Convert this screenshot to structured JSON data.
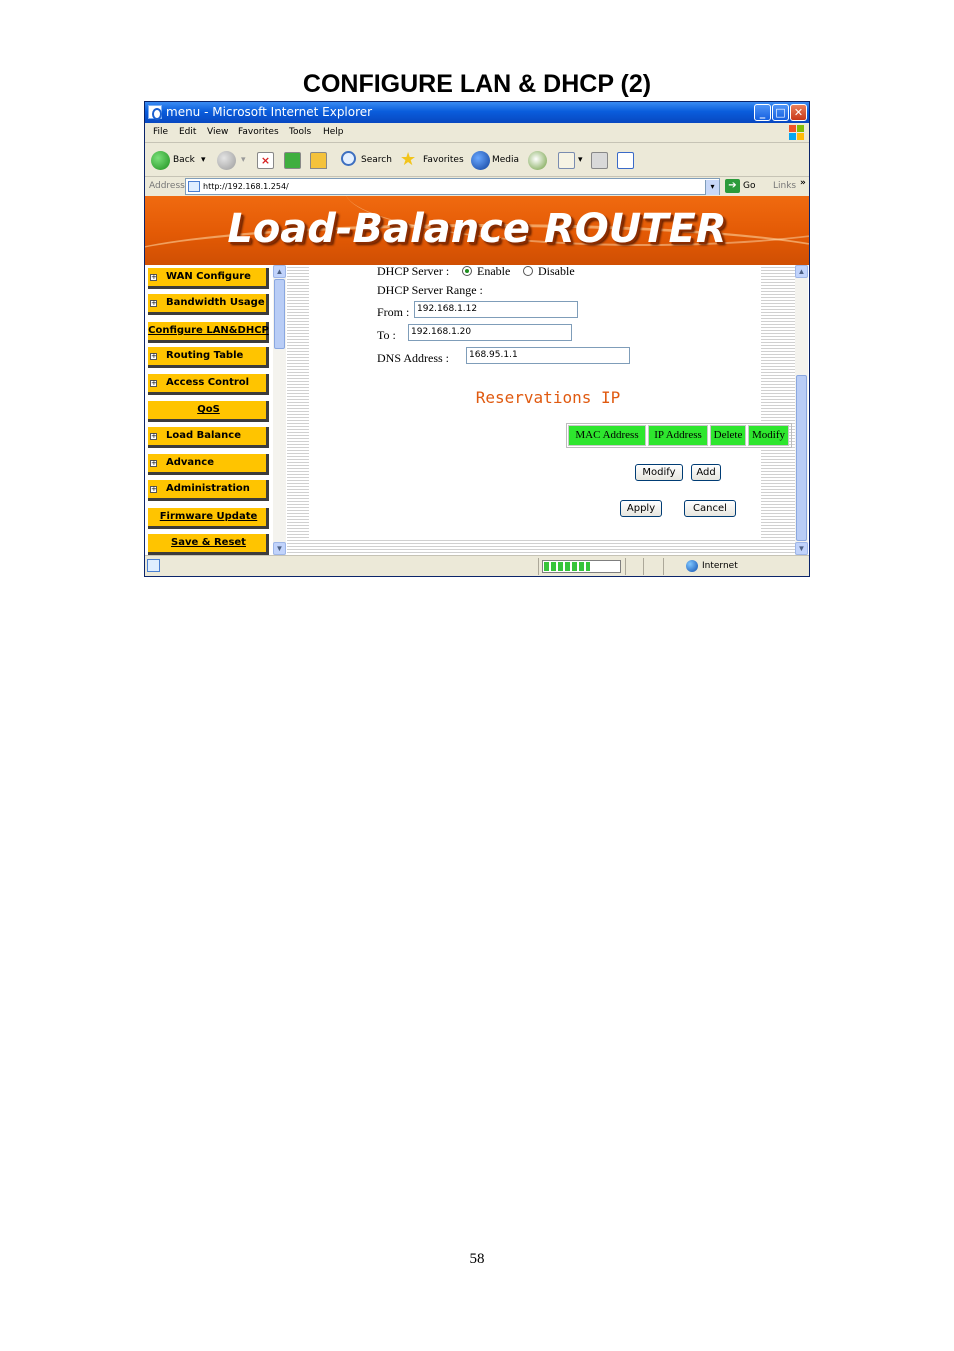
{
  "document": {
    "title": "CONFIGURE LAN & DHCP (2)",
    "page_number": "58"
  },
  "window": {
    "title": "menu - Microsoft Internet Explorer",
    "buttons": {
      "minimize": "_",
      "maximize": "□",
      "close": "✕"
    }
  },
  "menubar": {
    "items": [
      "File",
      "Edit",
      "View",
      "Favorites",
      "Tools",
      "Help"
    ]
  },
  "toolbar": {
    "back": "Back",
    "search": "Search",
    "favorites": "Favorites",
    "media": "Media"
  },
  "addressbar": {
    "label": "Address",
    "url": "http://192.168.1.254/",
    "go": "Go",
    "links": "Links",
    "chevron": "»"
  },
  "banner": {
    "title": "Load-Balance ROUTER"
  },
  "nav": {
    "items": [
      {
        "label": "WAN Configure",
        "expandable": true
      },
      {
        "label": "Bandwidth Usage",
        "expandable": true
      },
      {
        "label": "Configure LAN&DHCP",
        "expandable": false
      },
      {
        "label": "Routing Table",
        "expandable": true
      },
      {
        "label": "Access Control",
        "expandable": true
      },
      {
        "label": "QoS",
        "expandable": false
      },
      {
        "label": "Load Balance",
        "expandable": true
      },
      {
        "label": "Advance",
        "expandable": true
      },
      {
        "label": "Administration",
        "expandable": true
      },
      {
        "label": "Firmware Update",
        "expandable": false
      },
      {
        "label": "Save & Reset",
        "expandable": false
      }
    ],
    "plus": "+"
  },
  "form": {
    "dhcp_server_label": "DHCP Server :",
    "enable_label": "Enable",
    "disable_label": "Disable",
    "dhcp_server_value": "Enable",
    "range_label": "DHCP Server Range :",
    "from_label": "From :",
    "from_value": "192.168.1.12",
    "to_label": "To :",
    "to_value": "192.168.1.20",
    "dns_label": "DNS Address :",
    "dns_value": "168.95.1.1"
  },
  "reservations": {
    "title": "Reservations IP",
    "columns": [
      "MAC Address",
      "IP Address",
      "Delete",
      "Modify"
    ],
    "modify_button": "Modify",
    "add_button": "Add",
    "apply_button": "Apply",
    "cancel_button": "Cancel"
  },
  "statusbar": {
    "zone": "Internet",
    "progress": 1.0
  },
  "colors": {
    "nav_item": "#ffc400",
    "banner": "#e35a05",
    "header_cell": "#2ee62e",
    "reservations_title": "#e05a10"
  }
}
